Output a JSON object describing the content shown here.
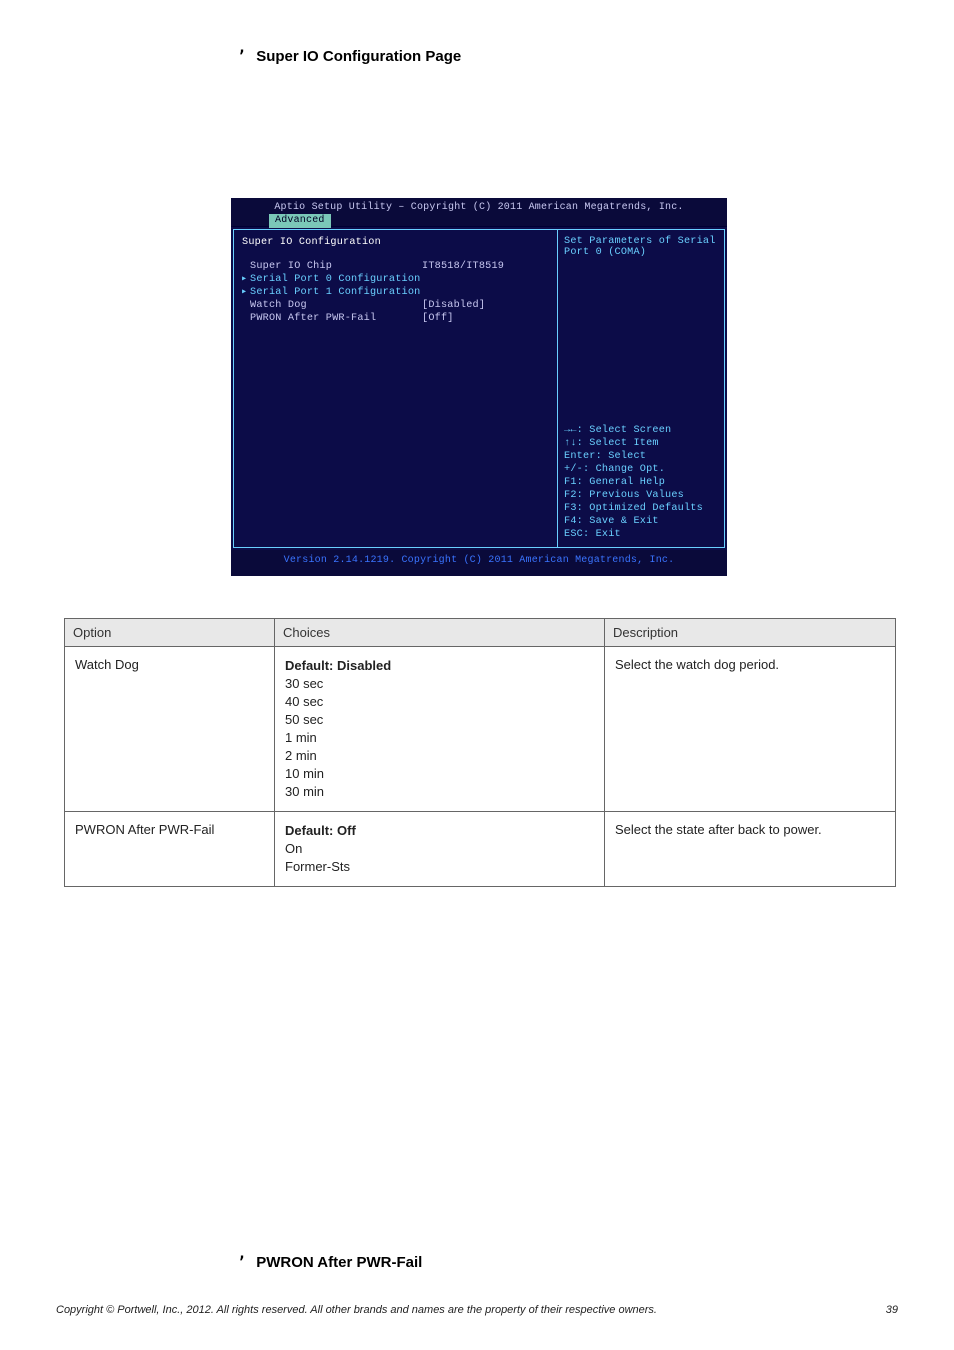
{
  "headings": {
    "top": {
      "icon": "’",
      "text": "Super IO Configuration Page"
    },
    "bottom": {
      "icon": "’",
      "text": "PWRON After PWR-Fail"
    }
  },
  "bios": {
    "title": "Aptio Setup Utility – Copyright (C) 2011 American Megatrends, Inc.",
    "tab": "Advanced",
    "section_title": "Super IO Configuration",
    "items": [
      {
        "label": "Super IO Chip",
        "value": "IT8518/IT8519",
        "type": "plain"
      },
      {
        "label": "Serial Port 0 Configuration",
        "value": "",
        "type": "submenu"
      },
      {
        "label": "Serial Port 1 Configuration",
        "value": "",
        "type": "submenu"
      },
      {
        "label": "Watch Dog",
        "value": "[Disabled]",
        "type": "setting"
      },
      {
        "label": "PWRON After PWR-Fail",
        "value": "[Off]",
        "type": "setting"
      }
    ],
    "help_top": "Set Parameters of Serial Port 0 (COMA)",
    "help_keys": [
      "→←: Select Screen",
      "↑↓: Select Item",
      "Enter: Select",
      "+/-: Change Opt.",
      "F1: General Help",
      "F2: Previous Values",
      "F3: Optimized Defaults",
      "F4: Save & Exit",
      "ESC: Exit"
    ],
    "footer": "Version 2.14.1219. Copyright (C) 2011 American Megatrends, Inc."
  },
  "table": {
    "headers": {
      "option": "Option",
      "choices": "Choices",
      "desc": "Description"
    },
    "rows": [
      {
        "option": "Watch Dog",
        "choices": [
          "Default: Disabled",
          "30 sec",
          "40 sec",
          "50 sec",
          "1 min",
          "2 min",
          "10 min",
          "30 min"
        ],
        "desc": "Select the watch dog period."
      },
      {
        "option": "PWRON After PWR-Fail",
        "choices": [
          "Default: Off",
          "On",
          "Former-Sts"
        ],
        "desc": "Select the state after back to power."
      }
    ]
  },
  "footer": {
    "left": "Copyright © Portwell, Inc., 2012. All rights reserved. All other brands and names are the property of their respective owners.",
    "page": "39"
  }
}
